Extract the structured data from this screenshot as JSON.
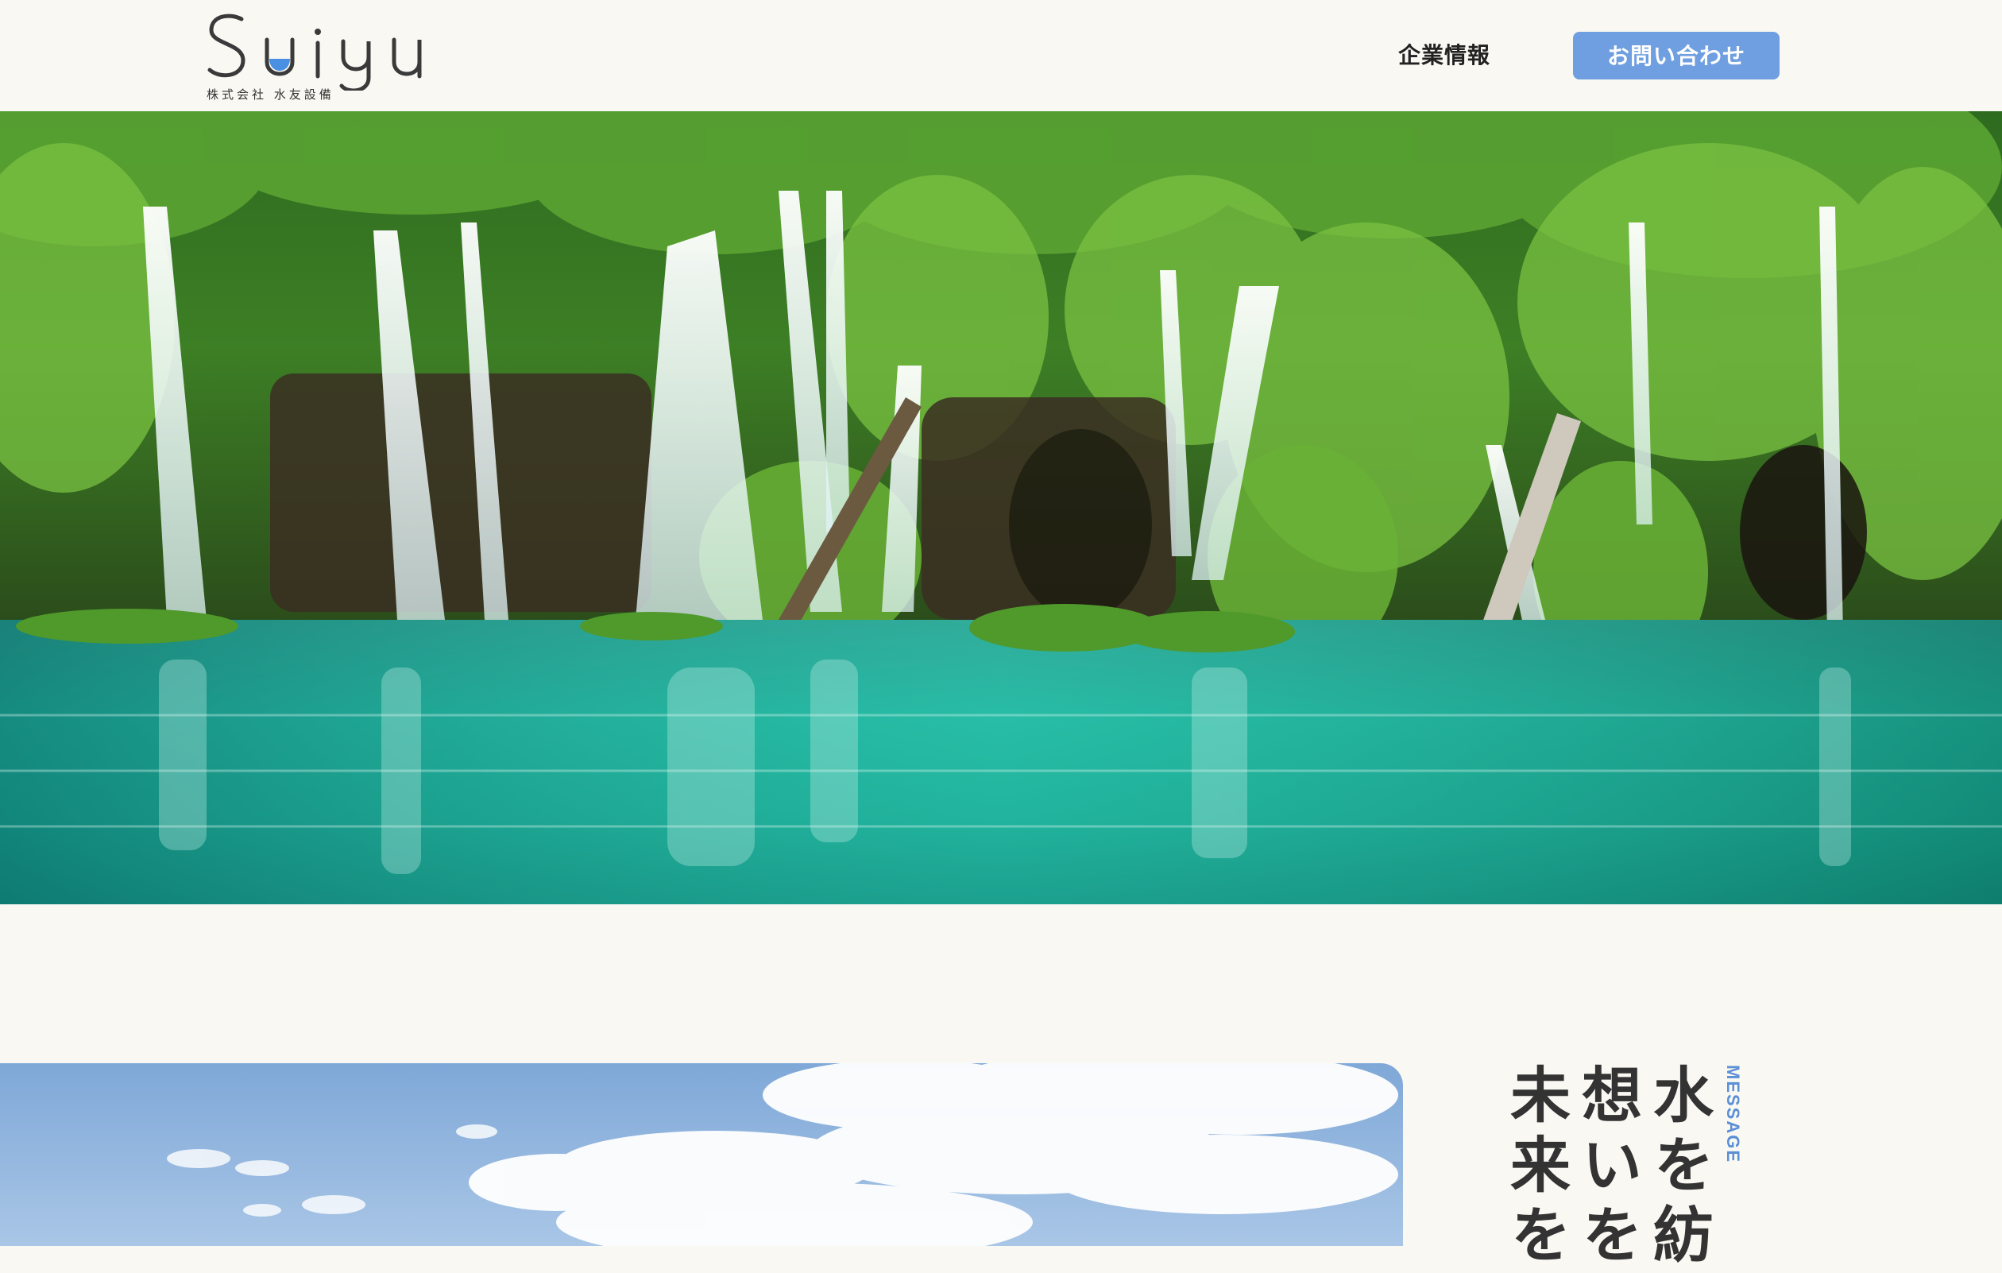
{
  "header": {
    "logo_text": "Suiyu",
    "logo_subtext": "株式会社 水友設備",
    "nav_company": "企業情報",
    "contact_label": "お問い合わせ"
  },
  "hero": {
    "image_subject": "waterfall-lake"
  },
  "message": {
    "section_label": "MESSAGE",
    "lines": [
      "水を紡",
      "想いを",
      "未来を"
    ]
  },
  "colors": {
    "background": "#faf8f3",
    "accent": "#6f9fe0",
    "text": "#333333",
    "logo_water": "#4a90e2"
  }
}
